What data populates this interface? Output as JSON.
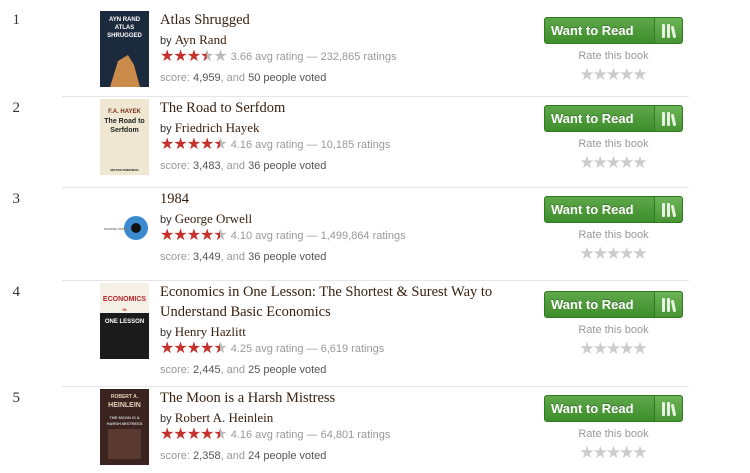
{
  "colors": {
    "star_full": "#c5312b",
    "star_empty": "#bbbbbb",
    "button_green": "#409d30",
    "title_brown": "#382110"
  },
  "labels": {
    "by": "by",
    "want_to_read": "Want to Read",
    "rate_this_book": "Rate this book",
    "score_prefix": "score:",
    "and": ", and",
    "voted_suffix": "people voted"
  },
  "books": [
    {
      "rank": "1",
      "title": "Atlas Shrugged",
      "author": "Ayn Rand",
      "rating_fill": 3.5,
      "rating_text": "3.66 avg rating — 232,865 ratings",
      "score": "4,959",
      "voters": "50",
      "cover": {
        "lines": [
          "AYN RAND",
          "ATLAS",
          "SHRUGGED"
        ],
        "bg": "#1c2a3e",
        "accent": "#c98a4a"
      }
    },
    {
      "rank": "2",
      "title": "The Road to Serfdom",
      "author": "Friedrich Hayek",
      "rating_fill": 4.5,
      "rating_text": "4.16 avg rating — 10,185 ratings",
      "score": "3,483",
      "voters": "36",
      "cover": {
        "lines": [
          "F.A. HAYEK",
          "The Road to",
          "Serfdom",
          "MILTON FRIEDMAN"
        ],
        "bg": "#efe7d2",
        "accent": "#7a2d1e"
      }
    },
    {
      "rank": "3",
      "title": "1984",
      "author": "George Orwell",
      "rating_fill": 4.5,
      "rating_text": "4.10 avg rating — 1,499,864 ratings",
      "score": "3,449",
      "voters": "36",
      "cover": {
        "lines": [
          "GEORGE ORWELL"
        ],
        "bg": "#ffffff",
        "accent": "#3a8ad0"
      }
    },
    {
      "rank": "4",
      "title": "Economics in One Lesson: The Shortest & Surest Way to Understand Basic Economics",
      "author": "Henry Hazlitt",
      "rating_fill": 4.5,
      "rating_text": "4.25 avg rating — 6,619 ratings",
      "score": "2,445",
      "voters": "25",
      "cover": {
        "lines": [
          "ECONOMICS",
          "IN",
          "ONE LESSON"
        ],
        "bg": "#f4f0e6",
        "accent": "#b8242a"
      }
    },
    {
      "rank": "5",
      "title": "The Moon is a Harsh Mistress",
      "author": "Robert A. Heinlein",
      "rating_fill": 4.5,
      "rating_text": "4.16 avg rating — 64,801 ratings",
      "score": "2,358",
      "voters": "24",
      "cover": {
        "lines": [
          "ROBERT A.",
          "HEINLEIN",
          "THE MOON IS A",
          "HARSH MISTRESS"
        ],
        "bg": "#3b2320",
        "accent": "#d9ccb0"
      }
    }
  ]
}
